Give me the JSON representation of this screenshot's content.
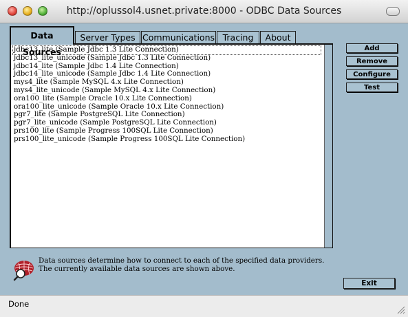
{
  "window": {
    "title": "http://oplussol4.usnet.private:8000 - ODBC Data Sources"
  },
  "tabs": [
    {
      "label": "Data Sources",
      "active": true
    },
    {
      "label": "Server Types",
      "active": false
    },
    {
      "label": "Communications",
      "active": false
    },
    {
      "label": "Tracing",
      "active": false
    },
    {
      "label": "About",
      "active": false
    }
  ],
  "data_sources": [
    "jdbc13_lite (Sample Jdbc 1.3 Lite Connection)",
    "jdbc13_lite_unicode (Sample Jdbc 1.3 Lite Connection)",
    "jdbc14_lite (Sample Jdbc 1.4 Lite Connection)",
    "jdbc14_lite_unicode (Sample Jdbc 1.4 Lite Connection)",
    "mys4_lite (Sample MySQL 4.x Lite Connection)",
    "mys4_lite_unicode (Sample MySQL 4.x Lite Connection)",
    "ora100_lite (Sample Oracle 10.x Lite Connection)",
    "ora100_lite_unicode (Sample Oracle 10.x Lite Connection)",
    "pgr7_lite (Sample PostgreSQL Lite Connection)",
    "pgr7_lite_unicode (Sample PostgreSQL Lite Connection)",
    "prs100_lite (Sample Progress 100SQL Lite Connection)",
    "prs100_lite_unicode (Sample Progress 100SQL Lite Connection)"
  ],
  "buttons": {
    "add": "Add",
    "remove": "Remove",
    "configure": "Configure",
    "test": "Test",
    "exit": "Exit"
  },
  "info": {
    "text": "Data sources determine how to connect to each of the specified data providers. The currently available data sources are shown above.",
    "icon": "data-providers-icon"
  },
  "status": {
    "text": "Done"
  },
  "colors": {
    "panel": "#a3bccc",
    "tab": "#a9c2d1",
    "list_bg": "#ffffff",
    "chrome": "#ececec"
  }
}
